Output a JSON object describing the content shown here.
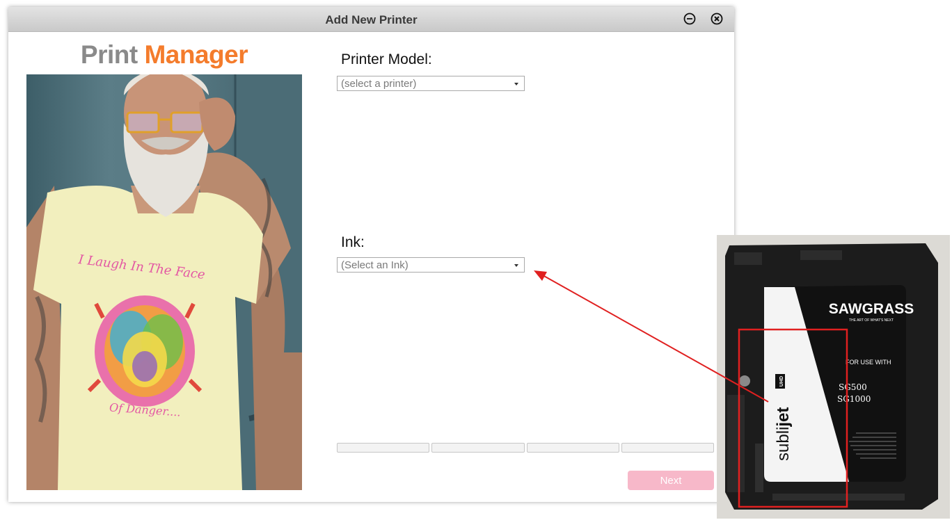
{
  "window": {
    "title": "Add New Printer",
    "minimize_icon": "minimize-circle-icon",
    "close_icon": "close-circle-icon"
  },
  "brand": {
    "word1": "Print",
    "word2": "Manager",
    "colors": {
      "word1": "#8a8a8a",
      "word2": "#f47c2c"
    }
  },
  "photo": {
    "shirt_line1": "I Laugh In The Face",
    "shirt_line2": "Of Danger...."
  },
  "form": {
    "printer_label": "Printer Model:",
    "printer_value": "(select a printer)",
    "ink_label": "Ink:",
    "ink_value": "(Select an Ink)"
  },
  "progress": {
    "segments": 4
  },
  "buttons": {
    "next_label": "Next",
    "next_color": "#f7b8c9"
  },
  "cartridge": {
    "brand": "SAWGRASS",
    "tagline": "THE ART OF WHAT'S NEXT",
    "for_use": "FOR USE WITH",
    "model1": "SG500",
    "model2": "SG1000",
    "product_prefix": "subli",
    "product_bold": "jet",
    "product_badge": "UHD"
  },
  "annotation": {
    "color": "#e02020"
  }
}
